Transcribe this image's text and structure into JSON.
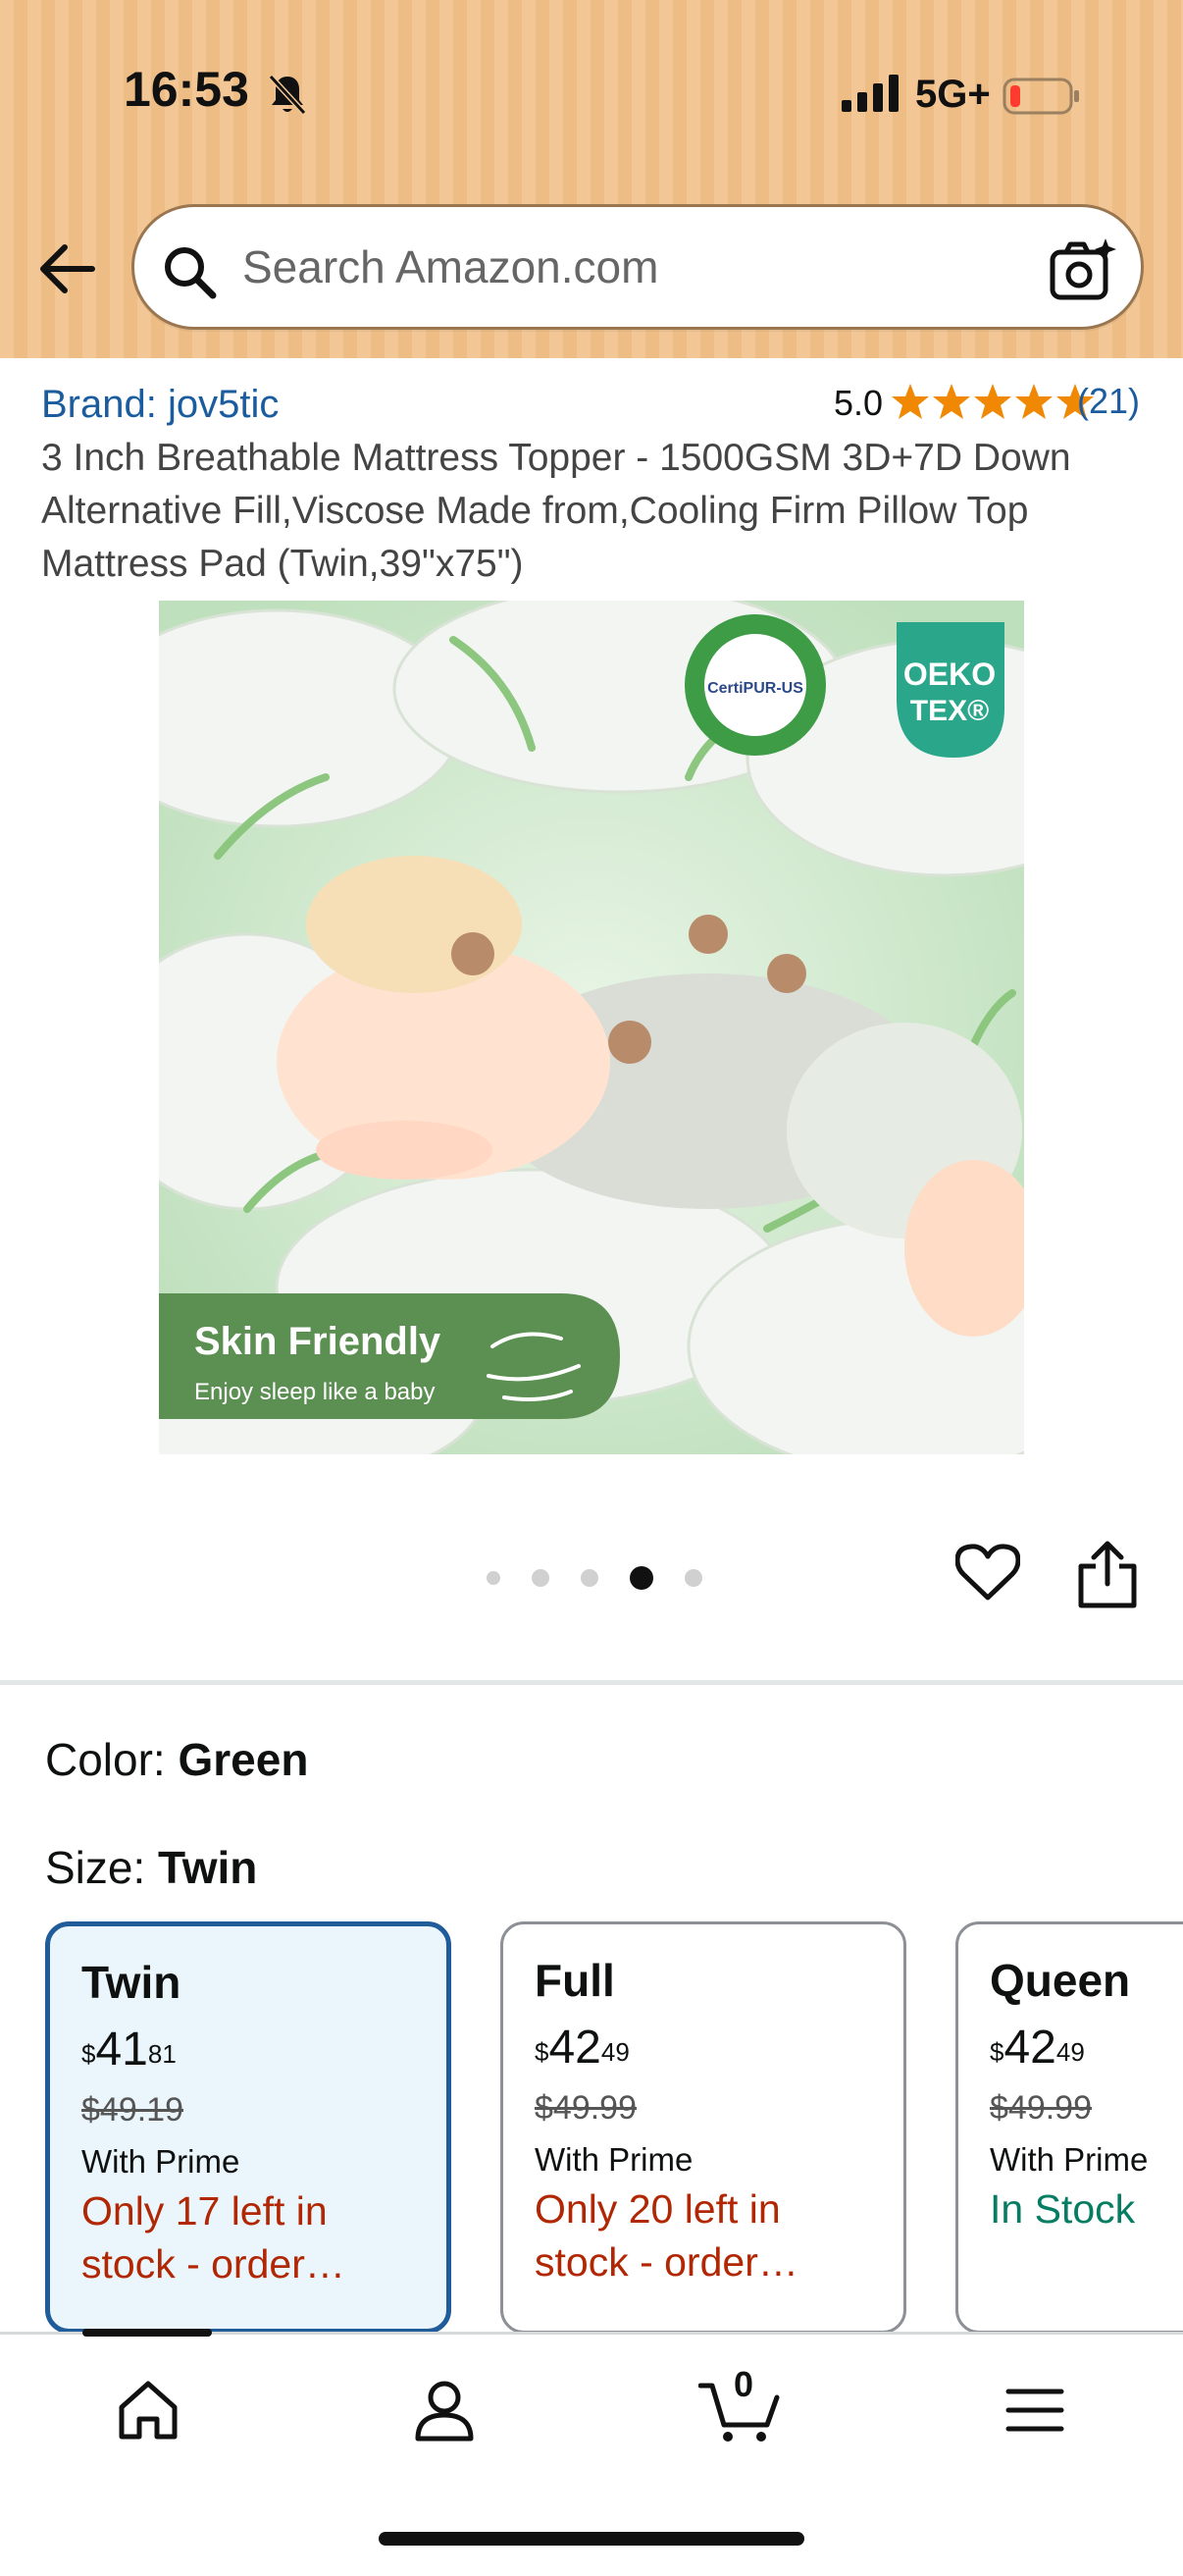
{
  "status_bar": {
    "time": "16:53",
    "network": "5G+"
  },
  "search": {
    "placeholder": "Search Amazon.com"
  },
  "product": {
    "brand": "Brand: jov5tic",
    "rating": "5.0",
    "stars": 5,
    "rating_count": "(21)",
    "title": "3 Inch Breathable Mattress Topper - 1500GSM 3D+7D Down Alternative Fill,Viscose Made from,Cooling Firm Pillow Top Mattress Pad (Twin,39\"x75\")"
  },
  "image": {
    "badge_oeko": "OEKO",
    "badge_tex": "TEX®",
    "badge_certipur": "CertiPUR-US",
    "banner_title": "Skin Friendly",
    "banner_subtitle": "Enjoy sleep like a baby",
    "pagination_total": 5,
    "pagination_active": 4
  },
  "variations": {
    "color_label": "Color:",
    "color_value": "Green",
    "size_label": "Size:",
    "size_value": "Twin",
    "cards": [
      {
        "name": "Twin",
        "currency": "$",
        "whole": "41",
        "fraction": "81",
        "list_price": "$49.19",
        "prime": "With Prime",
        "stock": "Only 17 left in stock - order…"
      },
      {
        "name": "Full",
        "currency": "$",
        "whole": "42",
        "fraction": "49",
        "list_price": "$49.99",
        "prime": "With Prime",
        "stock": "Only 20 left in stock - order…"
      },
      {
        "name": "Queen",
        "currency": "$",
        "whole": "42",
        "fraction": "49",
        "list_price": "$49.99",
        "prime": "With Prime",
        "stock": "In Stock"
      }
    ]
  },
  "nav": {
    "cart_count": "0"
  },
  "colors": {
    "link": "#1a5c9e",
    "star": "#f08804",
    "low_stock": "#b12704",
    "in_stock": "#067d62",
    "selected_border": "#1f5c99"
  }
}
